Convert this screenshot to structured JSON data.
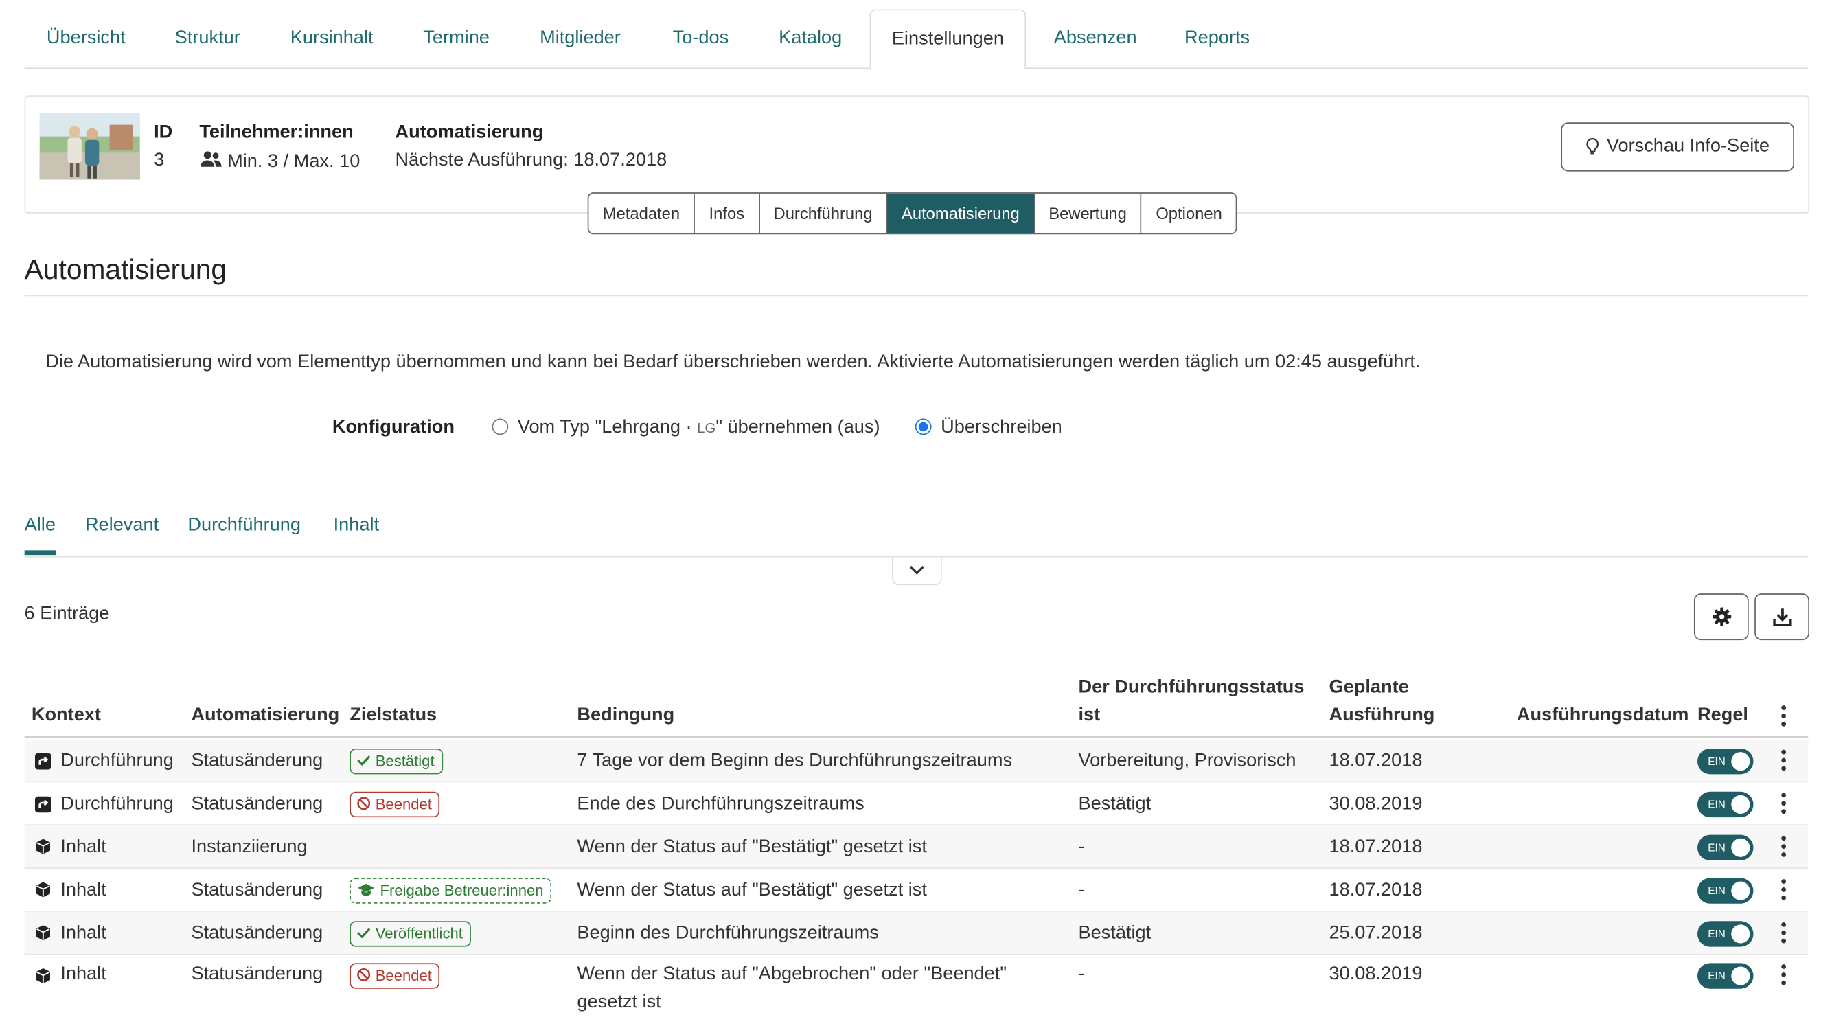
{
  "topnav": {
    "tabs": [
      "Übersicht",
      "Struktur",
      "Kursinhalt",
      "Termine",
      "Mitglieder",
      "To-dos",
      "Katalog",
      "Einstellungen",
      "Absenzen",
      "Reports"
    ],
    "active": "Einstellungen"
  },
  "course": {
    "id_label": "ID",
    "id_value": "3",
    "participants_label": "Teilnehmer:innen",
    "participants_value": "Min. 3 / Max. 10",
    "automation_label": "Automatisierung",
    "automation_value": "Nächste Ausführung: 18.07.2018",
    "preview_button": "Vorschau Info-Seite"
  },
  "subtabs": {
    "items": [
      "Metadaten",
      "Infos",
      "Durchführung",
      "Automatisierung",
      "Bewertung",
      "Optionen"
    ],
    "active": "Automatisierung"
  },
  "section": {
    "title": "Automatisierung",
    "description": "Die Automatisierung wird vom Elementtyp übernommen und kann bei Bedarf überschrieben werden. Aktivierte Automatisierungen werden täglich um 02:45 ausgeführt.",
    "config_label": "Konfiguration",
    "option_inherit_a": "Vom Typ \"Lehrgang ·",
    "option_inherit_tag": "LG",
    "option_inherit_b": "\" übernehmen (aus)",
    "option_override": "Überschreiben",
    "selected": "Überschreiben"
  },
  "filters": {
    "items": [
      "Alle",
      "Relevant",
      "Durchführung",
      "Inhalt"
    ],
    "active": "Alle"
  },
  "table": {
    "count": "6 Einträge",
    "headers": {
      "kontext": "Kontext",
      "automatisierung": "Automatisierung",
      "zielstatus": "Zielstatus",
      "bedingung": "Bedingung",
      "status_line1": "Der Durchführungsstatus",
      "status_line2": "ist",
      "geplant_line1": "Geplante",
      "geplant_line2": "Ausführung",
      "ausfuehrungsdatum": "Ausführungsdatum",
      "regel": "Regel"
    },
    "toggle_label": "EIN",
    "rows": [
      {
        "kontext": "Durchführung",
        "context_icon": "share-square-icon",
        "automatisierung": "Statusänderung",
        "zielstatus": "Bestätigt",
        "badge_icon": "check-icon",
        "badge_style": "green",
        "bedingung": "7 Tage vor dem Beginn des Durchführungszeitraums",
        "bedingung2": "",
        "status": "Vorbereitung, Provisorisch",
        "geplant": "18.07.2018",
        "datum": "",
        "regel": "EIN"
      },
      {
        "kontext": "Durchführung",
        "context_icon": "share-square-icon",
        "automatisierung": "Statusänderung",
        "zielstatus": "Beendet",
        "badge_icon": "ban-icon",
        "badge_style": "red",
        "bedingung": "Ende des Durchführungszeitraums",
        "bedingung2": "",
        "status": "Bestätigt",
        "geplant": "30.08.2019",
        "datum": "",
        "regel": "EIN"
      },
      {
        "kontext": "Inhalt",
        "context_icon": "cube-icon",
        "automatisierung": "Instanziierung",
        "zielstatus": "",
        "badge_icon": "",
        "badge_style": "",
        "bedingung": "Wenn der Status auf \"Bestätigt\" gesetzt ist",
        "bedingung2": "",
        "status": "-",
        "geplant": "18.07.2018",
        "datum": "",
        "regel": "EIN"
      },
      {
        "kontext": "Inhalt",
        "context_icon": "cube-icon",
        "automatisierung": "Statusänderung",
        "zielstatus": "Freigabe Betreuer:innen",
        "badge_icon": "graduation-cap-icon",
        "badge_style": "dashed",
        "bedingung": "Wenn der Status auf \"Bestätigt\" gesetzt ist",
        "bedingung2": "",
        "status": "-",
        "geplant": "18.07.2018",
        "datum": "",
        "regel": "EIN"
      },
      {
        "kontext": "Inhalt",
        "context_icon": "cube-icon",
        "automatisierung": "Statusänderung",
        "zielstatus": "Veröffentlicht",
        "badge_icon": "check-icon",
        "badge_style": "green",
        "bedingung": "Beginn des Durchführungszeitraums",
        "bedingung2": "",
        "status": "Bestätigt",
        "geplant": "25.07.2018",
        "datum": "",
        "regel": "EIN"
      },
      {
        "kontext": "Inhalt",
        "context_icon": "cube-icon",
        "automatisierung": "Statusänderung",
        "zielstatus": "Beendet",
        "badge_icon": "ban-icon",
        "badge_style": "red",
        "bedingung": "Wenn der Status auf \"Abgebrochen\" oder \"Beendet\"",
        "bedingung2": "gesetzt ist",
        "status": "-",
        "geplant": "30.08.2019",
        "datum": "",
        "regel": "EIN"
      }
    ]
  },
  "colors": {
    "accent": "#1f5c63",
    "link": "#1f6b6e",
    "success": "#2e7d32",
    "danger": "#b33a2f",
    "radio": "#1a73e8"
  }
}
